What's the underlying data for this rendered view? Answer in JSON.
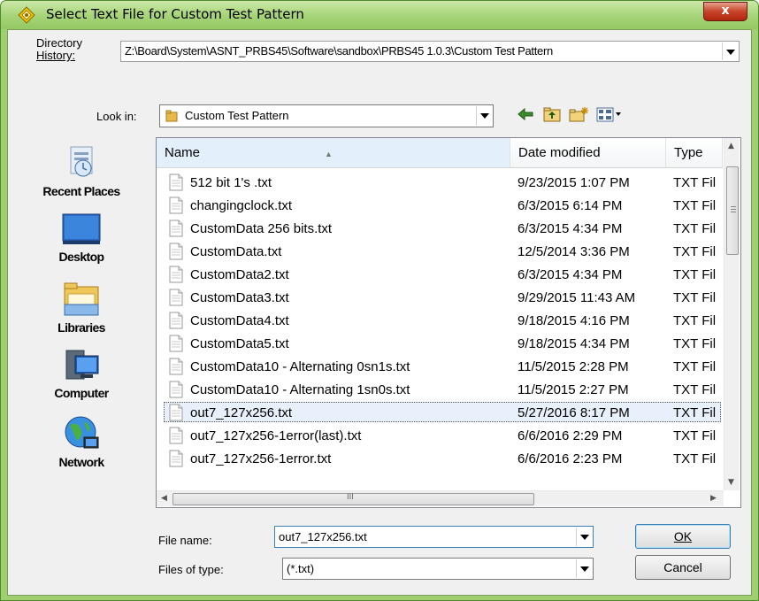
{
  "window": {
    "title": "Select Text File for Custom Test Pattern",
    "close_label": "x",
    "title_icon": "app-icon"
  },
  "directory_history": {
    "label_line1": "Directory",
    "label_line2": "History:",
    "value": "Z:\\Board\\System\\ASNT_PRBS45\\Software\\sandbox\\PRBS45 1.0.3\\Custom Test Pattern"
  },
  "look_in": {
    "label": "Look in:",
    "value": "Custom Test Pattern"
  },
  "toolbar": {
    "icons": [
      "back-icon",
      "up-folder-icon",
      "new-folder-icon",
      "view-menu-icon"
    ]
  },
  "places": [
    {
      "label": "Recent Places",
      "icon": "recent-places-icon"
    },
    {
      "label": "Desktop",
      "icon": "desktop-icon"
    },
    {
      "label": "Libraries",
      "icon": "libraries-icon"
    },
    {
      "label": "Computer",
      "icon": "computer-icon"
    },
    {
      "label": "Network",
      "icon": "network-icon"
    }
  ],
  "file_list": {
    "columns": [
      "Name",
      "Date modified",
      "Type"
    ],
    "rows": [
      {
        "name": "512 bit 1's .txt",
        "date": "9/23/2015 1:07 PM",
        "type": "TXT Fil"
      },
      {
        "name": "changingclock.txt",
        "date": "6/3/2015 6:14 PM",
        "type": "TXT Fil"
      },
      {
        "name": "CustomData 256 bits.txt",
        "date": "6/3/2015 4:34 PM",
        "type": "TXT Fil"
      },
      {
        "name": "CustomData.txt",
        "date": "12/5/2014 3:36 PM",
        "type": "TXT Fil"
      },
      {
        "name": "CustomData2.txt",
        "date": "6/3/2015 4:34 PM",
        "type": "TXT Fil"
      },
      {
        "name": "CustomData3.txt",
        "date": "9/29/2015 11:43 AM",
        "type": "TXT Fil"
      },
      {
        "name": "CustomData4.txt",
        "date": "9/18/2015 4:16 PM",
        "type": "TXT Fil"
      },
      {
        "name": "CustomData5.txt",
        "date": "9/18/2015 4:34 PM",
        "type": "TXT Fil"
      },
      {
        "name": "CustomData10 - Alternating 0sn1s.txt",
        "date": "11/5/2015 2:28 PM",
        "type": "TXT Fil"
      },
      {
        "name": "CustomData10 - Alternating 1sn0s.txt",
        "date": "11/5/2015 2:27 PM",
        "type": "TXT Fil"
      },
      {
        "name": "out7_127x256.txt",
        "date": "5/27/2016 8:17 PM",
        "type": "TXT Fil",
        "selected": true
      },
      {
        "name": "out7_127x256-1error(last).txt",
        "date": "6/6/2016 2:29 PM",
        "type": "TXT Fil"
      },
      {
        "name": "out7_127x256-1error.txt",
        "date": "6/6/2016 2:23 PM",
        "type": "TXT Fil"
      }
    ]
  },
  "file_name": {
    "label": "File name:",
    "value": "out7_127x256.txt"
  },
  "file_type": {
    "label": "Files of type:",
    "value": "(*.txt)"
  },
  "buttons": {
    "ok": "OK",
    "cancel": "Cancel"
  },
  "colors": {
    "title_bar": "#a8d57a",
    "selection": "#e8f1fb",
    "client": "#f0f0f0"
  }
}
